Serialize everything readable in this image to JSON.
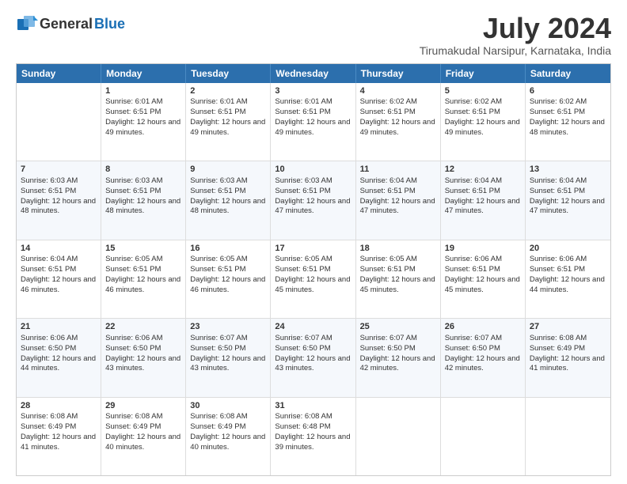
{
  "logo": {
    "general": "General",
    "blue": "Blue"
  },
  "title": {
    "month_year": "July 2024",
    "location": "Tirumakudal Narsipur, Karnataka, India"
  },
  "calendar": {
    "headers": [
      "Sunday",
      "Monday",
      "Tuesday",
      "Wednesday",
      "Thursday",
      "Friday",
      "Saturday"
    ],
    "rows": [
      [
        {
          "day": "",
          "sunrise": "",
          "sunset": "",
          "daylight": ""
        },
        {
          "day": "1",
          "sunrise": "Sunrise: 6:01 AM",
          "sunset": "Sunset: 6:51 PM",
          "daylight": "Daylight: 12 hours and 49 minutes."
        },
        {
          "day": "2",
          "sunrise": "Sunrise: 6:01 AM",
          "sunset": "Sunset: 6:51 PM",
          "daylight": "Daylight: 12 hours and 49 minutes."
        },
        {
          "day": "3",
          "sunrise": "Sunrise: 6:01 AM",
          "sunset": "Sunset: 6:51 PM",
          "daylight": "Daylight: 12 hours and 49 minutes."
        },
        {
          "day": "4",
          "sunrise": "Sunrise: 6:02 AM",
          "sunset": "Sunset: 6:51 PM",
          "daylight": "Daylight: 12 hours and 49 minutes."
        },
        {
          "day": "5",
          "sunrise": "Sunrise: 6:02 AM",
          "sunset": "Sunset: 6:51 PM",
          "daylight": "Daylight: 12 hours and 49 minutes."
        },
        {
          "day": "6",
          "sunrise": "Sunrise: 6:02 AM",
          "sunset": "Sunset: 6:51 PM",
          "daylight": "Daylight: 12 hours and 48 minutes."
        }
      ],
      [
        {
          "day": "7",
          "sunrise": "Sunrise: 6:03 AM",
          "sunset": "Sunset: 6:51 PM",
          "daylight": "Daylight: 12 hours and 48 minutes."
        },
        {
          "day": "8",
          "sunrise": "Sunrise: 6:03 AM",
          "sunset": "Sunset: 6:51 PM",
          "daylight": "Daylight: 12 hours and 48 minutes."
        },
        {
          "day": "9",
          "sunrise": "Sunrise: 6:03 AM",
          "sunset": "Sunset: 6:51 PM",
          "daylight": "Daylight: 12 hours and 48 minutes."
        },
        {
          "day": "10",
          "sunrise": "Sunrise: 6:03 AM",
          "sunset": "Sunset: 6:51 PM",
          "daylight": "Daylight: 12 hours and 47 minutes."
        },
        {
          "day": "11",
          "sunrise": "Sunrise: 6:04 AM",
          "sunset": "Sunset: 6:51 PM",
          "daylight": "Daylight: 12 hours and 47 minutes."
        },
        {
          "day": "12",
          "sunrise": "Sunrise: 6:04 AM",
          "sunset": "Sunset: 6:51 PM",
          "daylight": "Daylight: 12 hours and 47 minutes."
        },
        {
          "day": "13",
          "sunrise": "Sunrise: 6:04 AM",
          "sunset": "Sunset: 6:51 PM",
          "daylight": "Daylight: 12 hours and 47 minutes."
        }
      ],
      [
        {
          "day": "14",
          "sunrise": "Sunrise: 6:04 AM",
          "sunset": "Sunset: 6:51 PM",
          "daylight": "Daylight: 12 hours and 46 minutes."
        },
        {
          "day": "15",
          "sunrise": "Sunrise: 6:05 AM",
          "sunset": "Sunset: 6:51 PM",
          "daylight": "Daylight: 12 hours and 46 minutes."
        },
        {
          "day": "16",
          "sunrise": "Sunrise: 6:05 AM",
          "sunset": "Sunset: 6:51 PM",
          "daylight": "Daylight: 12 hours and 46 minutes."
        },
        {
          "day": "17",
          "sunrise": "Sunrise: 6:05 AM",
          "sunset": "Sunset: 6:51 PM",
          "daylight": "Daylight: 12 hours and 45 minutes."
        },
        {
          "day": "18",
          "sunrise": "Sunrise: 6:05 AM",
          "sunset": "Sunset: 6:51 PM",
          "daylight": "Daylight: 12 hours and 45 minutes."
        },
        {
          "day": "19",
          "sunrise": "Sunrise: 6:06 AM",
          "sunset": "Sunset: 6:51 PM",
          "daylight": "Daylight: 12 hours and 45 minutes."
        },
        {
          "day": "20",
          "sunrise": "Sunrise: 6:06 AM",
          "sunset": "Sunset: 6:51 PM",
          "daylight": "Daylight: 12 hours and 44 minutes."
        }
      ],
      [
        {
          "day": "21",
          "sunrise": "Sunrise: 6:06 AM",
          "sunset": "Sunset: 6:50 PM",
          "daylight": "Daylight: 12 hours and 44 minutes."
        },
        {
          "day": "22",
          "sunrise": "Sunrise: 6:06 AM",
          "sunset": "Sunset: 6:50 PM",
          "daylight": "Daylight: 12 hours and 43 minutes."
        },
        {
          "day": "23",
          "sunrise": "Sunrise: 6:07 AM",
          "sunset": "Sunset: 6:50 PM",
          "daylight": "Daylight: 12 hours and 43 minutes."
        },
        {
          "day": "24",
          "sunrise": "Sunrise: 6:07 AM",
          "sunset": "Sunset: 6:50 PM",
          "daylight": "Daylight: 12 hours and 43 minutes."
        },
        {
          "day": "25",
          "sunrise": "Sunrise: 6:07 AM",
          "sunset": "Sunset: 6:50 PM",
          "daylight": "Daylight: 12 hours and 42 minutes."
        },
        {
          "day": "26",
          "sunrise": "Sunrise: 6:07 AM",
          "sunset": "Sunset: 6:50 PM",
          "daylight": "Daylight: 12 hours and 42 minutes."
        },
        {
          "day": "27",
          "sunrise": "Sunrise: 6:08 AM",
          "sunset": "Sunset: 6:49 PM",
          "daylight": "Daylight: 12 hours and 41 minutes."
        }
      ],
      [
        {
          "day": "28",
          "sunrise": "Sunrise: 6:08 AM",
          "sunset": "Sunset: 6:49 PM",
          "daylight": "Daylight: 12 hours and 41 minutes."
        },
        {
          "day": "29",
          "sunrise": "Sunrise: 6:08 AM",
          "sunset": "Sunset: 6:49 PM",
          "daylight": "Daylight: 12 hours and 40 minutes."
        },
        {
          "day": "30",
          "sunrise": "Sunrise: 6:08 AM",
          "sunset": "Sunset: 6:49 PM",
          "daylight": "Daylight: 12 hours and 40 minutes."
        },
        {
          "day": "31",
          "sunrise": "Sunrise: 6:08 AM",
          "sunset": "Sunset: 6:48 PM",
          "daylight": "Daylight: 12 hours and 39 minutes."
        },
        {
          "day": "",
          "sunrise": "",
          "sunset": "",
          "daylight": ""
        },
        {
          "day": "",
          "sunrise": "",
          "sunset": "",
          "daylight": ""
        },
        {
          "day": "",
          "sunrise": "",
          "sunset": "",
          "daylight": ""
        }
      ]
    ]
  }
}
